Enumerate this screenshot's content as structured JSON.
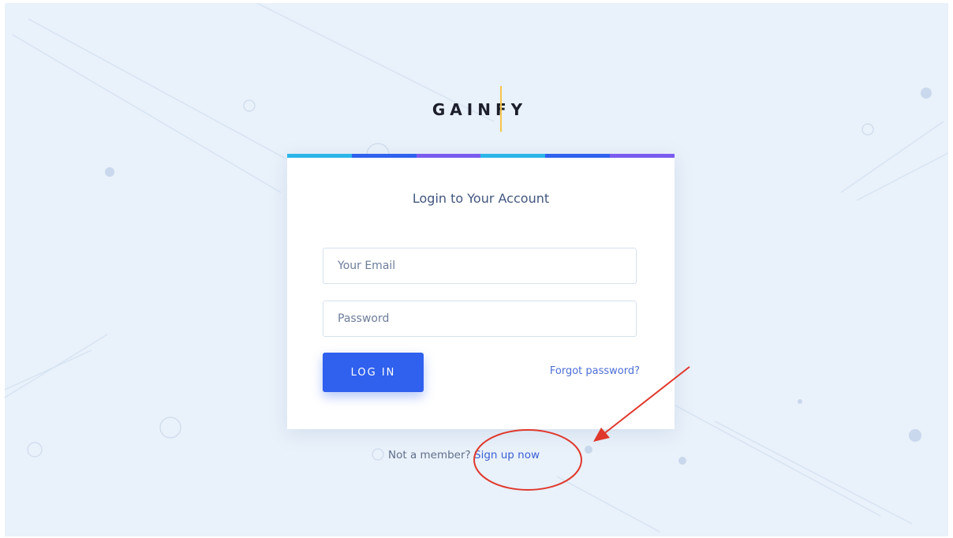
{
  "brand": {
    "logo_text": "GAINFY"
  },
  "login_card": {
    "title": "Login to Your Account",
    "email_placeholder": "Your Email",
    "password_placeholder": "Password",
    "login_button_label": "LOG IN",
    "forgot_password_label": "Forgot password?"
  },
  "signup": {
    "prompt": "Not a member?",
    "link_label": "Sign up now"
  },
  "colors": {
    "page_background": "#e9f1fa",
    "card_background": "#ffffff",
    "title_text": "#42567f",
    "login_button": "#2f60ee",
    "link": "#4d6fd6",
    "logo_separator": "#f4c54a",
    "annotation_red": "#e0382c",
    "top_bar_segments": [
      "#2bb5e8",
      "#2f60ee",
      "#7a5bf0",
      "#2bb5e8",
      "#2f60ee",
      "#7a5bf0"
    ]
  }
}
